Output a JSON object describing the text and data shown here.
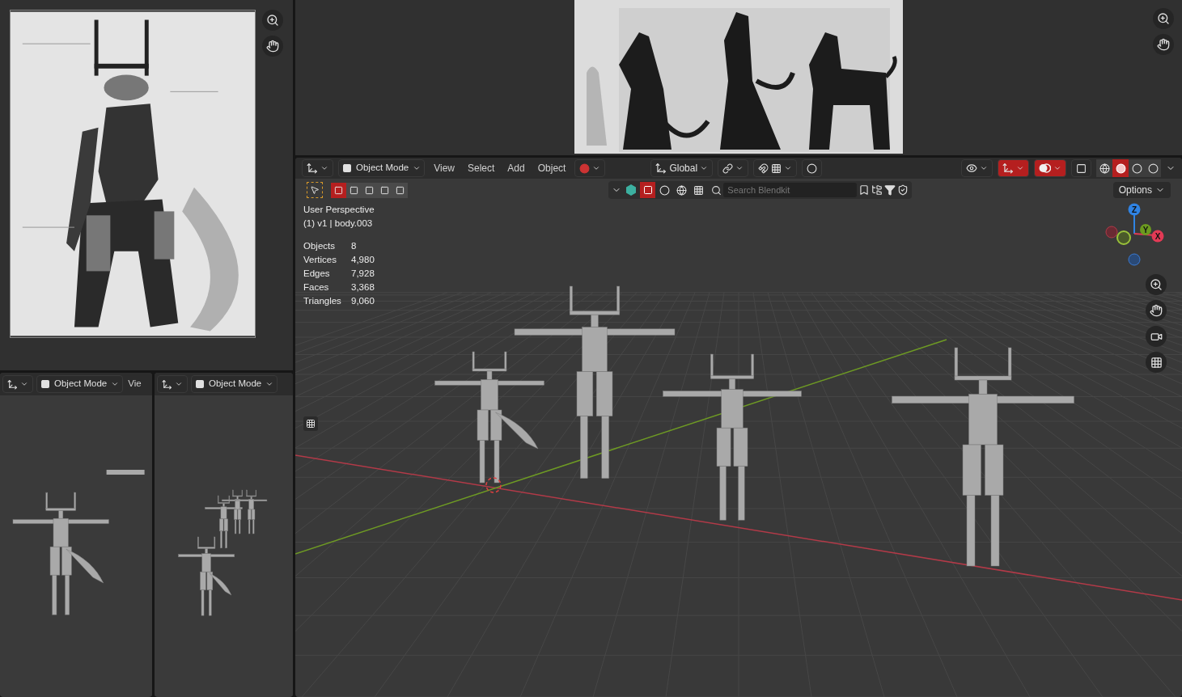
{
  "small_viewports": [
    {
      "mode": "Object Mode",
      "menus": [
        "Vie"
      ]
    },
    {
      "mode": "Object Mode"
    }
  ],
  "main_viewport": {
    "mode": "Object Mode",
    "menus": [
      "View",
      "Select",
      "Add",
      "Object"
    ],
    "orientation": "Global",
    "select_modes": [
      {
        "selected": true
      },
      {
        "selected": false
      },
      {
        "selected": false
      },
      {
        "selected": false
      },
      {
        "selected": false
      }
    ],
    "search": {
      "placeholder": "Search Blendkit"
    },
    "options": "Options",
    "gizmo_toggle": {
      "on": true
    },
    "overlay_toggle": {
      "on": true
    },
    "shading": [
      {
        "selected": false
      },
      {
        "selected": true
      },
      {
        "selected": false
      },
      {
        "selected": false
      }
    ],
    "overlay_title": "User Perspective",
    "overlay_object": "(1) v1 | body.003",
    "stats": [
      {
        "label": "Objects",
        "value": "8"
      },
      {
        "label": "Vertices",
        "value": "4,980"
      },
      {
        "label": "Edges",
        "value": "7,928"
      },
      {
        "label": "Faces",
        "value": "3,368"
      },
      {
        "label": "Triangles",
        "value": "9,060"
      }
    ],
    "gizmo": [
      {
        "axis": "Z",
        "color": "#2f83e3"
      },
      {
        "axis": "Y",
        "color": "#6b9a1f"
      },
      {
        "axis": "X",
        "color": "#e23a55"
      }
    ]
  }
}
